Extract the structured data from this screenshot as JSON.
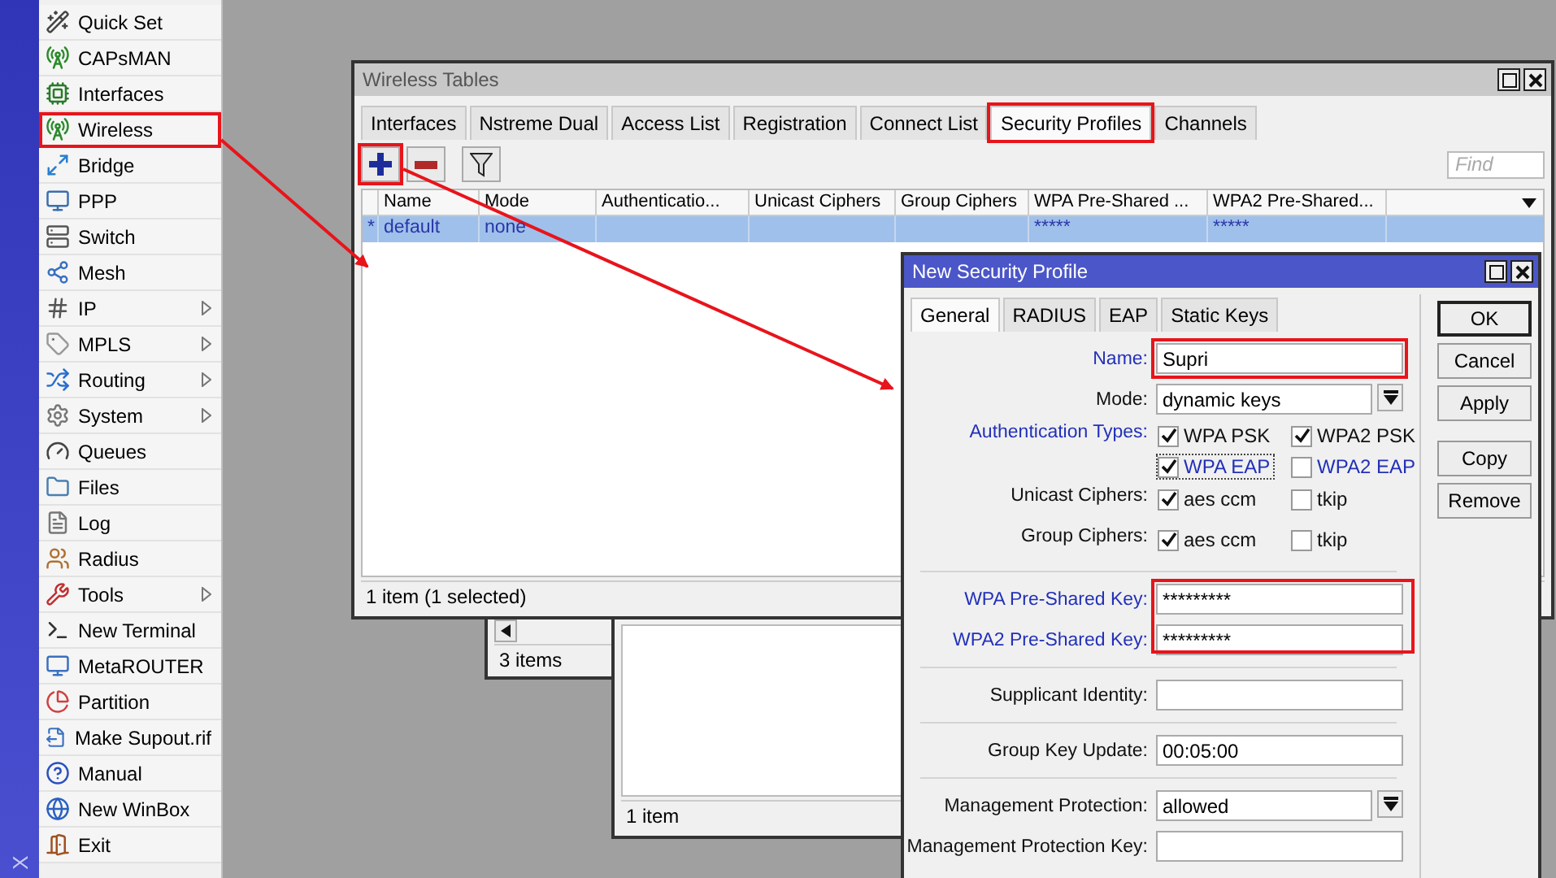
{
  "sidebar": {
    "brand": "X",
    "items": [
      {
        "label": "Quick Set",
        "submenu": false,
        "marked": false
      },
      {
        "label": "CAPsMAN",
        "submenu": false,
        "marked": false
      },
      {
        "label": "Interfaces",
        "submenu": false,
        "marked": false
      },
      {
        "label": "Wireless",
        "submenu": false,
        "marked": true
      },
      {
        "label": "Bridge",
        "submenu": false,
        "marked": false
      },
      {
        "label": "PPP",
        "submenu": false,
        "marked": false
      },
      {
        "label": "Switch",
        "submenu": false,
        "marked": false
      },
      {
        "label": "Mesh",
        "submenu": false,
        "marked": false
      },
      {
        "label": "IP",
        "submenu": true,
        "marked": false
      },
      {
        "label": "MPLS",
        "submenu": true,
        "marked": false
      },
      {
        "label": "Routing",
        "submenu": true,
        "marked": false
      },
      {
        "label": "System",
        "submenu": true,
        "marked": false
      },
      {
        "label": "Queues",
        "submenu": false,
        "marked": false
      },
      {
        "label": "Files",
        "submenu": false,
        "marked": false
      },
      {
        "label": "Log",
        "submenu": false,
        "marked": false
      },
      {
        "label": "Radius",
        "submenu": false,
        "marked": false
      },
      {
        "label": "Tools",
        "submenu": true,
        "marked": false
      },
      {
        "label": "New Terminal",
        "submenu": false,
        "marked": false
      },
      {
        "label": "MetaROUTER",
        "submenu": false,
        "marked": false
      },
      {
        "label": "Partition",
        "submenu": false,
        "marked": false
      },
      {
        "label": "Make Supout.rif",
        "submenu": false,
        "marked": false
      },
      {
        "label": "Manual",
        "submenu": false,
        "marked": false
      },
      {
        "label": "New WinBox",
        "submenu": false,
        "marked": false
      },
      {
        "label": "Exit",
        "submenu": false,
        "marked": false
      }
    ]
  },
  "background_windows": [
    {
      "status": "3 items"
    },
    {
      "status": "1 item"
    }
  ],
  "wireless_tables": {
    "title": "Wireless Tables",
    "tabs": [
      {
        "label": "Interfaces",
        "selected": false,
        "marked": false
      },
      {
        "label": "Nstreme Dual",
        "selected": false,
        "marked": false
      },
      {
        "label": "Access List",
        "selected": false,
        "marked": false
      },
      {
        "label": "Registration",
        "selected": false,
        "marked": false
      },
      {
        "label": "Connect List",
        "selected": false,
        "marked": false
      },
      {
        "label": "Security Profiles",
        "selected": true,
        "marked": true
      },
      {
        "label": "Channels",
        "selected": false,
        "marked": false
      }
    ],
    "toolbar": [
      {
        "kind": "add",
        "marked": true
      },
      {
        "kind": "remove",
        "marked": false
      },
      {
        "kind": "filter",
        "marked": false
      }
    ],
    "search": {
      "placeholder": "Find"
    },
    "table": {
      "columns": [
        "Name",
        "Mode",
        "Authenticatio...",
        "Unicast Ciphers",
        "Group Ciphers",
        "WPA Pre-Shared ...",
        "WPA2 Pre-Shared..."
      ],
      "rows": [
        {
          "flag": "*",
          "cells": [
            "default",
            "none",
            "",
            "",
            "",
            "*****",
            "*****"
          ],
          "selected": true
        }
      ]
    },
    "status": "1 item (1 selected)"
  },
  "dialog": {
    "title": "New Security Profile",
    "tabs": [
      {
        "label": "General",
        "selected": true
      },
      {
        "label": "RADIUS",
        "selected": false
      },
      {
        "label": "EAP",
        "selected": false
      },
      {
        "label": "Static Keys",
        "selected": false
      }
    ],
    "fields": [
      {
        "kind": "text",
        "label": "Name:",
        "value": "Supri",
        "emphasized": true,
        "marked": true
      },
      {
        "kind": "select",
        "label": "Mode:",
        "value": "dynamic keys",
        "emphasized": false
      },
      {
        "kind": "checks",
        "label": "Authentication Types:",
        "emphasized": true,
        "options": [
          {
            "label": "WPA PSK",
            "checked": true,
            "emphasized": false,
            "focused": false
          },
          {
            "label": "WPA2 PSK",
            "checked": true,
            "emphasized": false,
            "focused": false
          },
          {
            "label": "WPA EAP",
            "checked": true,
            "emphasized": true,
            "focused": true
          },
          {
            "label": "WPA2 EAP",
            "checked": false,
            "emphasized": true,
            "focused": false
          }
        ]
      },
      {
        "kind": "checks",
        "label": "Unicast Ciphers:",
        "emphasized": false,
        "options": [
          {
            "label": "aes ccm",
            "checked": true,
            "emphasized": false,
            "focused": false
          },
          {
            "label": "tkip",
            "checked": false,
            "emphasized": false,
            "focused": false
          }
        ]
      },
      {
        "kind": "checks",
        "label": "Group Ciphers:",
        "emphasized": false,
        "options": [
          {
            "label": "aes ccm",
            "checked": true,
            "emphasized": false,
            "focused": false
          },
          {
            "label": "tkip",
            "checked": false,
            "emphasized": false,
            "focused": false
          }
        ]
      },
      {
        "kind": "separator"
      },
      {
        "kind": "group",
        "marked": true,
        "fields": [
          {
            "kind": "text",
            "label": "WPA Pre-Shared Key:",
            "value": "*********",
            "emphasized": true
          },
          {
            "kind": "text",
            "label": "WPA2 Pre-Shared Key:",
            "value": "*********",
            "emphasized": true
          }
        ]
      },
      {
        "kind": "separator"
      },
      {
        "kind": "text",
        "label": "Supplicant Identity:",
        "emphasized": false
      },
      {
        "kind": "separator"
      },
      {
        "kind": "text",
        "label": "Group Key Update:",
        "value": "00:05:00",
        "emphasized": false
      },
      {
        "kind": "separator"
      },
      {
        "kind": "select",
        "label": "Management Protection:",
        "value": "allowed",
        "emphasized": false
      },
      {
        "kind": "text",
        "label": "Management Protection Key:",
        "emphasized": false
      }
    ],
    "buttons": [
      {
        "label": "OK",
        "default": true
      },
      {
        "label": "Cancel",
        "default": false
      },
      {
        "label": "Apply",
        "default": false
      },
      {
        "label": "Copy",
        "default": false
      },
      {
        "label": "Remove",
        "default": false
      }
    ]
  }
}
